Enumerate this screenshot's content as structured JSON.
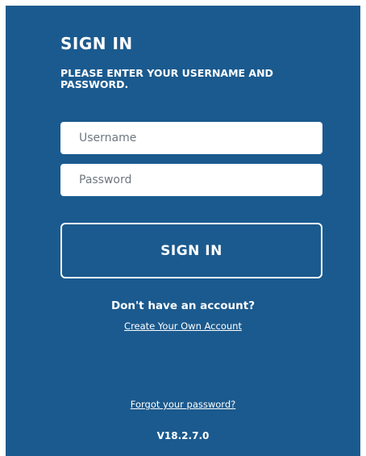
{
  "colors": {
    "panel_background": "#1b5a8e",
    "text": "#ffffff",
    "field_background": "#ffffff",
    "placeholder": "#6e7780"
  },
  "login": {
    "title": "SIGN IN",
    "subtitle": "PLEASE ENTER YOUR USERNAME AND PASSWORD.",
    "username": {
      "value": "",
      "placeholder": "Username"
    },
    "password": {
      "value": "",
      "placeholder": "Password"
    },
    "sign_in_label": "SIGN IN"
  },
  "signup": {
    "prompt": "Don't have an account?",
    "link_label": "Create Your Own Account"
  },
  "forgot_password_label": "Forgot your password?",
  "version": "V18.2.7.0"
}
